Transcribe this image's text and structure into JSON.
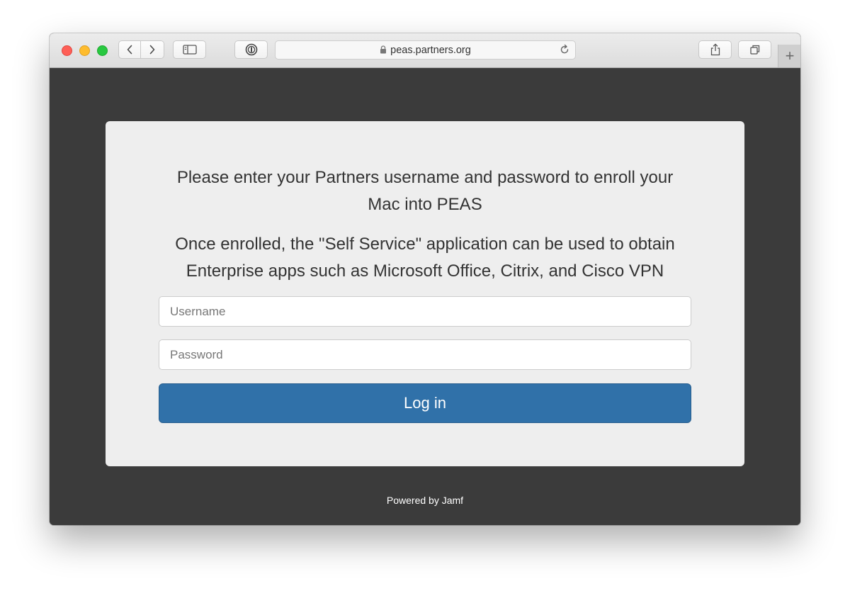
{
  "browser": {
    "url": "peas.partners.org"
  },
  "page": {
    "message_line1": "Please enter your Partners username and password to enroll your Mac into PEAS",
    "message_line2": "Once enrolled, the \"Self Service\" application can be used to obtain Enterprise apps such as Microsoft Office, Citrix, and Cisco VPN",
    "username_placeholder": "Username",
    "password_placeholder": "Password",
    "login_label": "Log in",
    "footer": "Powered by Jamf"
  },
  "colors": {
    "page_background": "#3b3b3b",
    "card_background": "#eeeeee",
    "button": "#3071a9"
  },
  "icons": [
    "close-light",
    "minimize-light",
    "zoom-light",
    "back-icon",
    "forward-icon",
    "sidebar-icon",
    "password-manager-icon",
    "lock-icon",
    "reload-icon",
    "share-icon",
    "tabs-icon",
    "new-tab-icon"
  ]
}
